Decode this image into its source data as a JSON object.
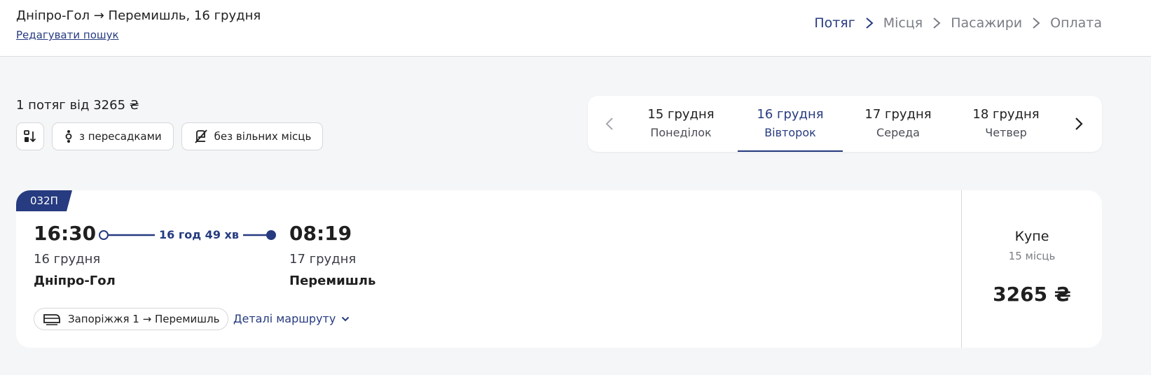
{
  "header": {
    "route_title": "Дніпро-Гол → Перемишль, 16 грудня",
    "edit_link": "Редагувати пошук",
    "steps": [
      "Потяг",
      "Місця",
      "Пасажири",
      "Оплата"
    ],
    "active_step": 0
  },
  "results": {
    "count_text": "1 потяг від 3265 ₴"
  },
  "filters": {
    "sort_icon": "sort-icon",
    "transfers_label": "з пересадками",
    "no_seats_label": "без вільних місць"
  },
  "date_picker": {
    "tabs": [
      {
        "date": "15 грудня",
        "weekday": "Понеділок"
      },
      {
        "date": "16 грудня",
        "weekday": "Вівторок"
      },
      {
        "date": "17 грудня",
        "weekday": "Середа"
      },
      {
        "date": "18 грудня",
        "weekday": "Четвер"
      }
    ],
    "active_index": 1
  },
  "train": {
    "number": "032П",
    "departure_time": "16:30",
    "departure_date": "16 грудня",
    "departure_station": "Дніпро-Гол",
    "duration": "16 год 49 хв",
    "arrival_time": "08:19",
    "arrival_date": "17 грудня",
    "arrival_station": "Перемишль",
    "route_label": "Запоріжжя 1 → Перемишль",
    "details_label": "Деталі маршруту",
    "class": {
      "name": "Купе",
      "seats": "15 місць",
      "price": "3265 ₴"
    }
  },
  "colors": {
    "accent": "#263b80",
    "background": "#f5f6f8"
  }
}
